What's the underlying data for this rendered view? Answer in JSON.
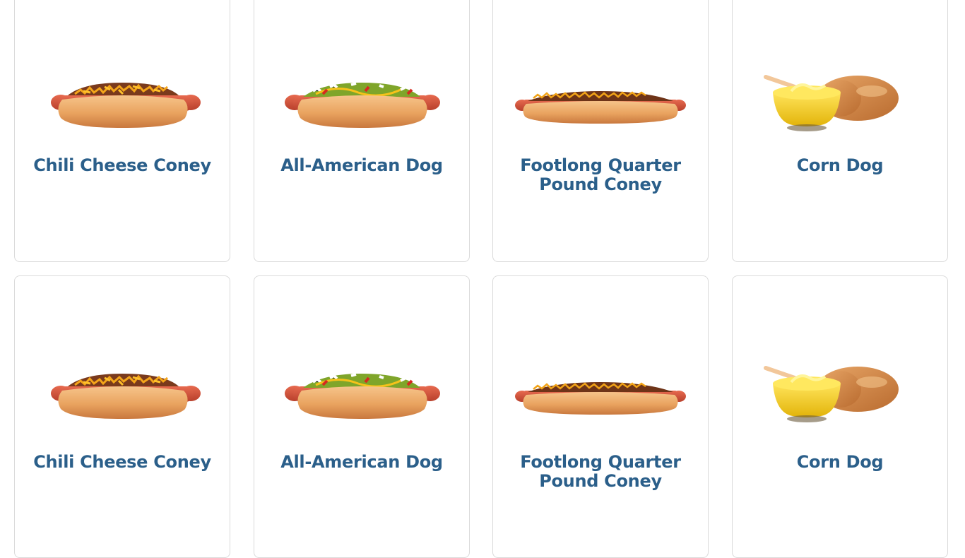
{
  "theme": {
    "title_color": "#2b5f8a"
  },
  "menu": {
    "items": [
      {
        "name": "Chili Cheese Coney",
        "image": "chili-cheese-coney"
      },
      {
        "name": "All-American Dog",
        "image": "all-american-dog"
      },
      {
        "name": "Footlong Quarter Pound Coney",
        "image": "footlong-quarter-pound-coney"
      },
      {
        "name": "Corn Dog",
        "image": "corn-dog"
      },
      {
        "name": "Chili Cheese Coney",
        "image": "chili-cheese-coney"
      },
      {
        "name": "All-American Dog",
        "image": "all-american-dog"
      },
      {
        "name": "Footlong Quarter Pound Coney",
        "image": "footlong-quarter-pound-coney"
      },
      {
        "name": "Corn Dog",
        "image": "corn-dog"
      }
    ]
  }
}
